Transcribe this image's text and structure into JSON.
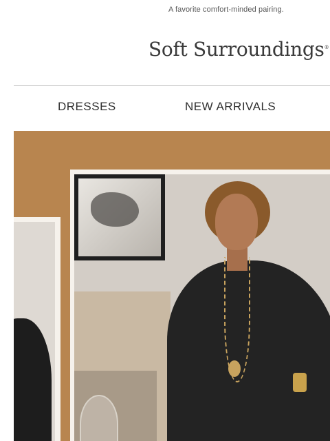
{
  "preheader": {
    "text": "A favorite comfort-minded pairing."
  },
  "brand": {
    "name": "Soft Surroundings",
    "trademark": "®"
  },
  "nav": {
    "items": [
      {
        "label": "DRESSES"
      },
      {
        "label": "NEW ARRIVALS"
      }
    ]
  },
  "colors": {
    "hero_background": "#b8854f",
    "panel": "#f6f2ec",
    "text": "#2f2f2f"
  }
}
